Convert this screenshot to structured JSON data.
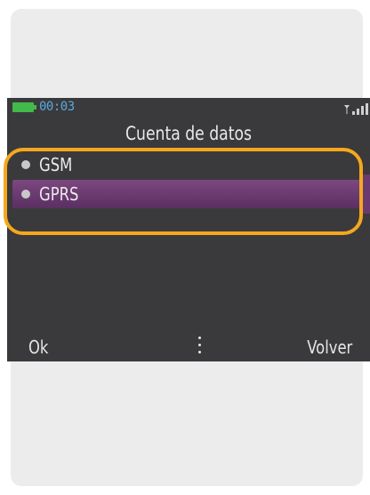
{
  "status": {
    "time": "00:03",
    "battery_color": "#43b94a",
    "clock_color": "#5aa8e0",
    "signal_icon": "signal-strength-icon"
  },
  "screen": {
    "title": "Cuenta de datos",
    "items": [
      {
        "label": "GSM",
        "selected": false
      },
      {
        "label": "GPRS",
        "selected": true
      }
    ],
    "selection_color": "#6d3c72",
    "highlight_ring_color": "#f5a81d"
  },
  "softkeys": {
    "left": "Ok",
    "center_icon": "more-options-icon",
    "right": "Volver"
  }
}
